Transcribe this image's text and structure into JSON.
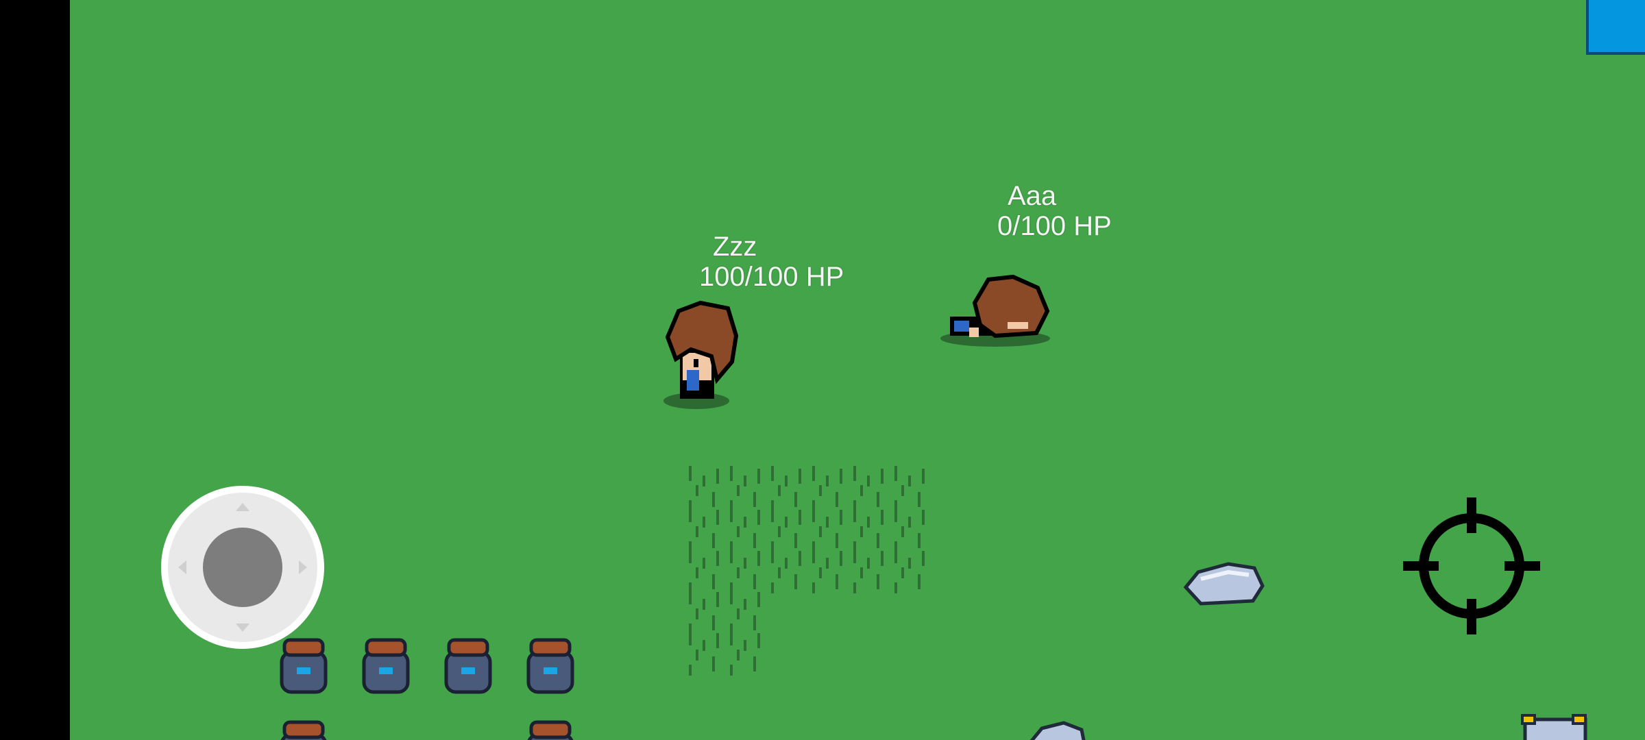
{
  "players": [
    {
      "name": "Zzz",
      "hp": "100/100 HP"
    },
    {
      "name": "Aaa",
      "hp": "0/100 HP"
    }
  ],
  "colors": {
    "grass": "#44a449",
    "grass_dark": "#2f6f35",
    "shadow": "#2c6a31",
    "hair": "#8a4a28",
    "skin": "#f2c9a6",
    "shirt": "#2d67c7",
    "rock": "#b9c6df",
    "pot": "#4a5a7a",
    "menu_button": "#0596e0",
    "joystick_base": "#e9e9e9",
    "joystick_knob": "#7d7d7d",
    "crosshair": "#000000"
  },
  "icons": {
    "joystick": "virtual-joystick-icon",
    "aim": "crosshair-icon",
    "corner": "menu-button"
  }
}
